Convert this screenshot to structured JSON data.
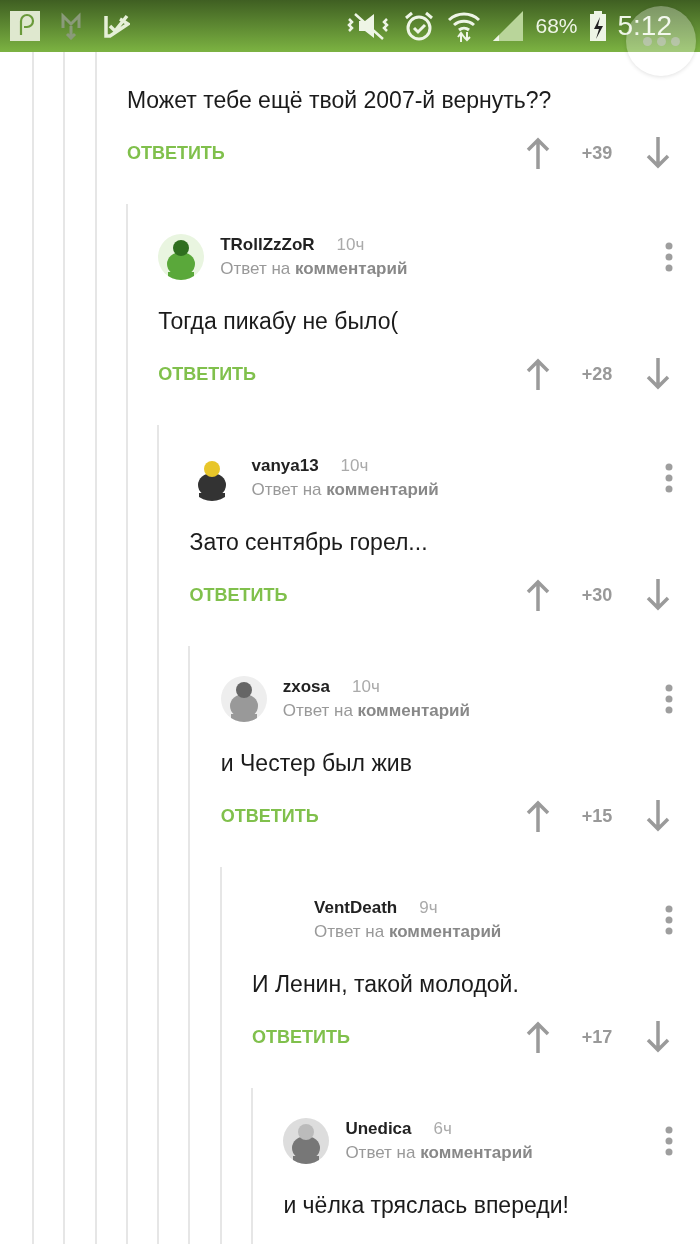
{
  "status_bar": {
    "battery": "68%",
    "time": "5:12"
  },
  "comments": [
    {
      "body": "Может тебе ещё твой 2007-й вернуть??",
      "reply_button": "ОТВЕТИТЬ",
      "score": "+39",
      "children": [
        {
          "author": "TRollZzZoR",
          "time": "10ч",
          "has_avatar": true,
          "reply_to": "Ответ на **комментарий**",
          "body": "Тогда пикабу не было(",
          "reply_button": "ОТВЕТИТЬ",
          "score": "+28",
          "children": [
            {
              "author": "vanya13",
              "time": "10ч",
              "has_avatar": true,
              "reply_to": "Ответ на **комментарий**",
              "body": "Зато сентябрь горел...",
              "reply_button": "ОТВЕТИТЬ",
              "score": "+30",
              "children": [
                {
                  "author": "zxosa",
                  "time": "10ч",
                  "has_avatar": true,
                  "reply_to": "Ответ на **комментарий**",
                  "body": "и Честер был жив",
                  "reply_button": "ОТВЕТИТЬ",
                  "score": "+15",
                  "children": [
                    {
                      "author": "VentDeath",
                      "time": "9ч",
                      "has_avatar": false,
                      "reply_to": "Ответ на **комментарий**",
                      "body": "И Ленин, такой молодой.",
                      "reply_button": "ОТВЕТИТЬ",
                      "score": "+17",
                      "children": [
                        {
                          "author": "Unedica",
                          "time": "6ч",
                          "has_avatar": true,
                          "reply_to": "Ответ на **комментарий**",
                          "body": "и чёлка тряслась впереди!"
                        }
                      ]
                    }
                  ]
                }
              ]
            }
          ]
        }
      ]
    }
  ]
}
